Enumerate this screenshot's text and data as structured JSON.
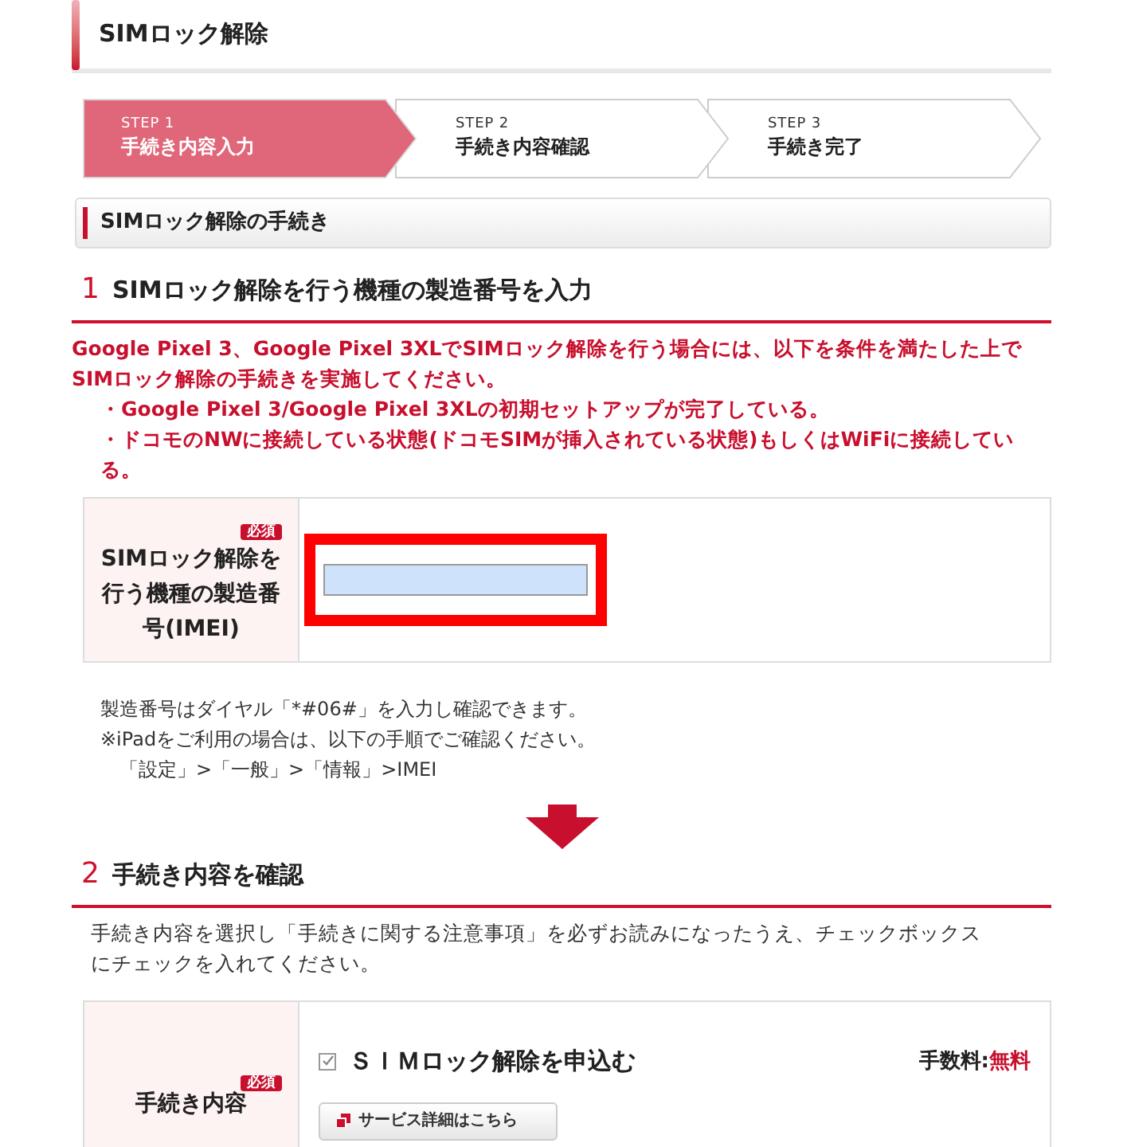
{
  "page_title": "SIMロック解除",
  "steps": [
    {
      "step": "STEP 1",
      "label": "手続き内容入力",
      "selected": true
    },
    {
      "step": "STEP 2",
      "label": "手続き内容確認",
      "selected": false
    },
    {
      "step": "STEP 3",
      "label": "手続き完了",
      "selected": false
    }
  ],
  "section_title": "SIMロック解除の手続き",
  "part1": {
    "number": "1",
    "heading": "SIMロック解除を行う機種の製造番号を入力",
    "notice": [
      "Google Pixel 3、Google Pixel 3XLでSIMロック解除を行う場合には、以下を条件を満たした上でSIMロック解除の手続きを実施してください。",
      "・Google Pixel 3/Google Pixel 3XLの初期セットアップが完了している。",
      "・ドコモのNWに接続している状態(ドコモSIMが挿入されている状態)もしくはWiFiに接続している。"
    ],
    "field": {
      "required": "必須",
      "label": "SIMロック解除を行う機種の製造番号(IMEI)"
    },
    "notes": [
      "製造番号はダイヤル「*#06#」を入力し確認できます。",
      "※iPadをご利用の場合は、以下の手順でご確認ください。",
      "「設定」>「一般」>「情報」>IMEI"
    ]
  },
  "part2": {
    "number": "2",
    "heading": "手続き内容を確認",
    "description": "手続き内容を選択し「手続きに関する注意事項」を必ずお読みになったうえ、チェックボックスにチェックを入れてください。",
    "row": {
      "required": "必須",
      "label": "手続き内容",
      "option": {
        "label": "ＳＩＭロック解除を申込む",
        "checked": true
      },
      "fee_label": "手数料:",
      "fee": "無料",
      "detail_button": "サービス詳細はこちら"
    }
  }
}
